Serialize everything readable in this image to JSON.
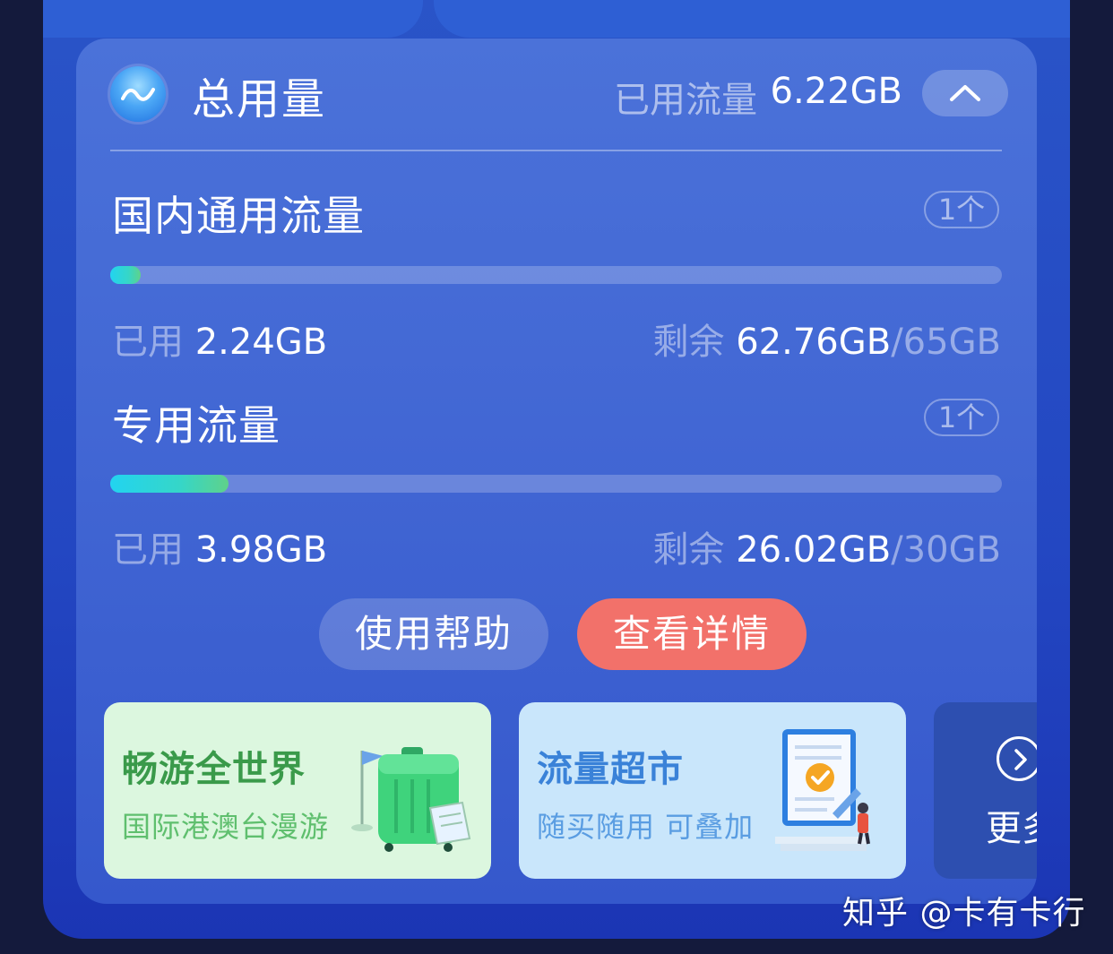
{
  "header": {
    "title": "总用量",
    "used_label": "已用流量",
    "used_value": "6.22GB",
    "logo_icon": "wave-logo-icon",
    "collapse_icon": "chevron-up-icon"
  },
  "sections": [
    {
      "title": "国内通用流量",
      "count": "1个",
      "used_label": "已用",
      "used_value": "2.24GB",
      "remaining_label": "剩余",
      "remaining_value": "62.76GB",
      "total": "/65GB",
      "progress_fraction": 0.0345
    },
    {
      "title": "专用流量",
      "count": "1个",
      "used_label": "已用",
      "used_value": "3.98GB",
      "remaining_label": "剩余",
      "remaining_value": "26.02GB",
      "total": "/30GB",
      "progress_fraction": 0.1327
    }
  ],
  "buttons": {
    "help": "使用帮助",
    "detail": "查看详情"
  },
  "promos": [
    {
      "title": "畅游全世界",
      "subtitle": "国际港澳台漫游",
      "icon": "suitcase-icon",
      "color": "#dcf7df"
    },
    {
      "title": "流量超市",
      "subtitle": "随买随用 可叠加",
      "icon": "document-check-icon",
      "color": "#c9e6fb"
    },
    {
      "label": "更多",
      "icon": "chevron-right-circle-icon"
    }
  ],
  "watermark": "知乎 @卡有卡行",
  "colors": {
    "background": "#141a3c",
    "card": "#4267d4",
    "progress_start": "#22d4f0",
    "progress_end": "#5fd28a",
    "detail_button": "#f2716a"
  }
}
